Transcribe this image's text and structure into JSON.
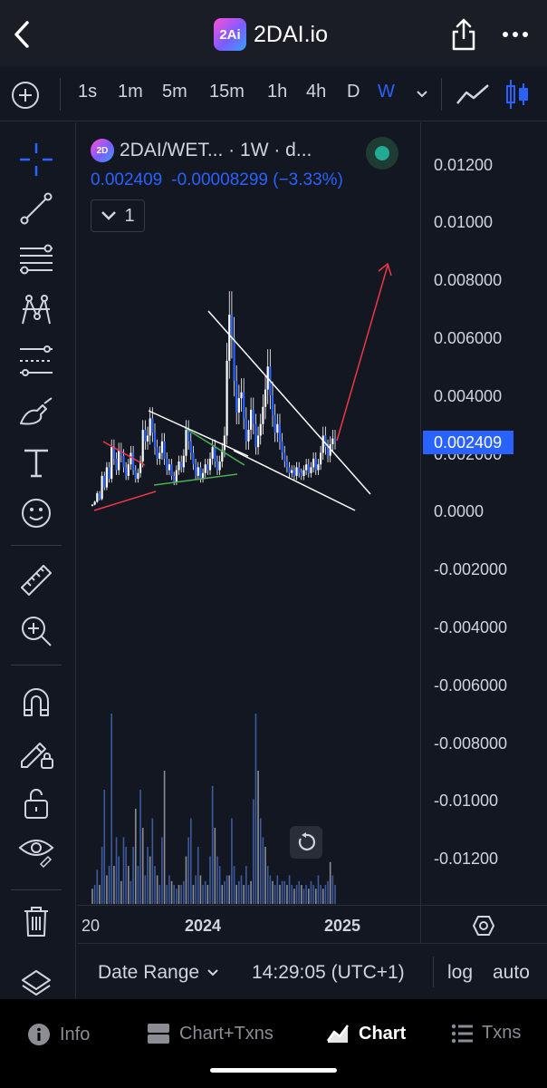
{
  "header": {
    "title": "2DAI.io",
    "logo_text": "2Ai"
  },
  "timeframes": {
    "items": [
      "1s",
      "1m",
      "5m",
      "15m",
      "1h",
      "4h",
      "D",
      "W"
    ],
    "active": "W"
  },
  "legend": {
    "symbol": "2DAI/WET... · 1W · d...",
    "logo_text": "2D",
    "last_price": "0.002409",
    "change": "-0.00008299 (−3.33%)",
    "collapse_count": "1"
  },
  "price_axis": {
    "ticks": [
      "0.01200",
      "0.01000",
      "0.008000",
      "0.006000",
      "0.004000",
      "0.002000",
      "0.0000",
      "-0.002000",
      "-0.004000",
      "-0.006000",
      "-0.008000",
      "-0.01000",
      "-0.01200"
    ],
    "last_label": "0.002409"
  },
  "time_axis": {
    "ticks": [
      "20",
      "2024",
      "2025"
    ]
  },
  "bottom_bar": {
    "date_range": "Date Range",
    "clock": "14:29:05 (UTC+1)",
    "log": "log",
    "auto": "auto"
  },
  "tabs": [
    {
      "label": "Info",
      "icon": "info-icon"
    },
    {
      "label": "Chart+Txns",
      "icon": "split-view-icon"
    },
    {
      "label": "Chart",
      "icon": "chart-icon",
      "active": true
    },
    {
      "label": "Txns",
      "icon": "list-icon"
    }
  ],
  "colors": {
    "background": "#131722",
    "accent": "#2962ff",
    "candle": "#2962ff",
    "trendline": "#ffffff",
    "red_line": "#f23645",
    "green_line": "#4caf50",
    "status": "#22ab94"
  },
  "chart_data": {
    "type": "candlestick",
    "interval": "1W",
    "last_price": 0.002409,
    "x_ticks": [
      "20",
      "2024",
      "2025"
    ],
    "ylim": [
      -0.013,
      0.0135
    ],
    "grid": false,
    "series": [
      {
        "closes": [
          0.0002,
          0.0003,
          0.0006,
          0.0004,
          0.0012,
          0.0008,
          0.0015,
          0.0011,
          0.0022,
          0.0018,
          0.0014,
          0.0021,
          0.0019,
          0.0015,
          0.0012,
          0.0016,
          0.002,
          0.0014,
          0.0011,
          0.0013,
          0.0017,
          0.0028,
          0.0024,
          0.0026,
          0.0032,
          0.0027,
          0.0022,
          0.0018,
          0.002,
          0.0024,
          0.0018,
          0.0014,
          0.0016,
          0.0012,
          0.001,
          0.0014,
          0.0017,
          0.0015,
          0.0019,
          0.0028,
          0.0024,
          0.002,
          0.0016,
          0.0012,
          0.0015,
          0.0011,
          0.0013,
          0.0016,
          0.0014,
          0.0018,
          0.0022,
          0.0017,
          0.0014,
          0.0017,
          0.0021,
          0.0026,
          0.0052,
          0.0068,
          0.006,
          0.0045,
          0.0034,
          0.0039,
          0.0041,
          0.0032,
          0.0024,
          0.0028,
          0.0035,
          0.003,
          0.0022,
          0.0026,
          0.003,
          0.0036,
          0.0042,
          0.005,
          0.004,
          0.0033,
          0.0027,
          0.003,
          0.0024,
          0.002,
          0.0017,
          0.0015,
          0.0013,
          0.0014,
          0.0012,
          0.0015,
          0.0013,
          0.0012,
          0.0014,
          0.0016,
          0.0013,
          0.0015,
          0.0018,
          0.0014,
          0.0016,
          0.002,
          0.0026,
          0.0022,
          0.0019,
          0.0023,
          0.0025,
          0.002409
        ],
        "volumes": [
          0.08,
          0.1,
          0.18,
          0.1,
          0.3,
          0.6,
          0.15,
          0.2,
          1.0,
          0.2,
          0.35,
          0.25,
          0.12,
          0.35,
          0.3,
          0.2,
          0.12,
          0.3,
          0.5,
          0.2,
          0.6,
          0.4,
          0.15,
          0.3,
          0.25,
          0.45,
          0.2,
          0.15,
          0.1,
          0.35,
          0.7,
          0.1,
          0.15,
          0.12,
          0.1,
          0.08,
          0.1,
          0.1,
          0.12,
          0.25,
          0.35,
          0.45,
          0.1,
          0.15,
          0.3,
          0.15,
          0.1,
          0.12,
          0.1,
          0.25,
          0.62,
          0.4,
          0.25,
          0.2,
          0.1,
          0.12,
          0.15,
          0.15,
          0.45,
          0.2,
          0.1,
          0.12,
          0.15,
          0.1,
          0.2,
          0.1,
          0.12,
          0.55,
          1.0,
          0.7,
          0.45,
          0.35,
          0.3,
          0.2,
          0.15,
          0.12,
          0.1,
          0.15,
          0.1,
          0.12,
          0.12,
          0.1,
          0.15,
          0.1,
          0.08,
          0.1,
          0.12,
          0.1,
          0.08,
          0.1,
          0.08,
          0.12,
          0.1,
          0.08,
          0.15,
          0.1,
          0.08,
          0.1,
          0.12,
          0.22,
          0.15,
          0.1
        ]
      }
    ]
  }
}
